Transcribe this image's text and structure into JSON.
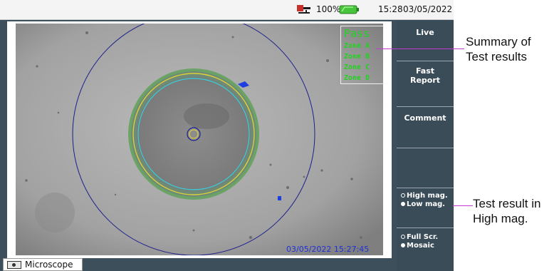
{
  "status_bar": {
    "battery_percent": "100%",
    "time": "15:28",
    "date": "03/05/2022",
    "icons": [
      "usb-connection-icon",
      "battery-icon"
    ]
  },
  "result_box": {
    "status": "Pass",
    "zones": [
      "Zone A",
      "Zone B",
      "Zone C",
      "Zone D"
    ]
  },
  "image": {
    "timestamp": "03/05/2022 15:27:45"
  },
  "sidebar": {
    "live_label": "Live",
    "fast_report_line1": "Fast",
    "fast_report_line2": "Report",
    "comment_label": "Comment",
    "magnification_options": [
      "High mag.",
      "Low mag."
    ],
    "magnification_selected": "Low mag.",
    "view_options": [
      "Full Scr.",
      "Mosaic"
    ],
    "view_selected": "Mosaic"
  },
  "tab": {
    "label": "Microscope"
  },
  "annotations": {
    "summary_line1": "Summary of",
    "summary_line2": "Test results",
    "mag_line1": "Test result in",
    "mag_line2": "High mag."
  },
  "colors": {
    "pass_text": "#21d31f",
    "timestamp_text": "#1f2fd6",
    "leader_line": "#c23ad0",
    "sidebar_bg": "#3b4c59"
  }
}
